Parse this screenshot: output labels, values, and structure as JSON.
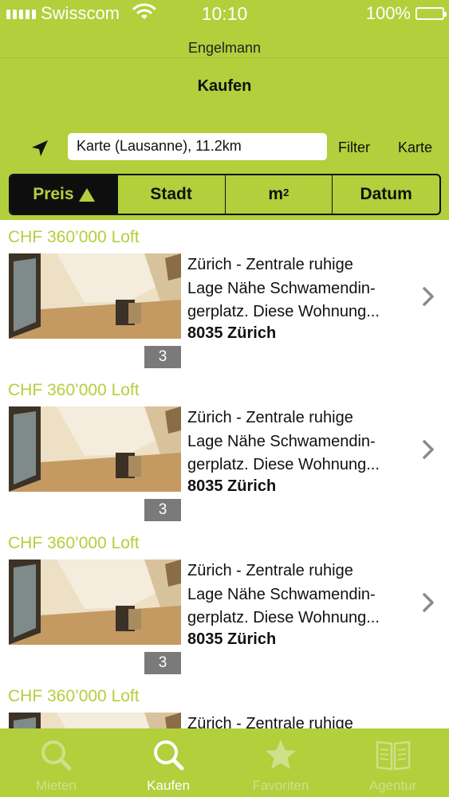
{
  "status_bar": {
    "carrier": "Swisscom",
    "time": "10:10",
    "battery": "100%"
  },
  "header": {
    "brand": "Engelmann",
    "title": "Kaufen"
  },
  "search": {
    "value": "Karte (Lausanne), 11.2km",
    "filter_label": "Filter",
    "map_label": "Karte"
  },
  "sort": {
    "options": [
      "Preis",
      "Stadt",
      "m",
      "Datum"
    ],
    "m_superscript": "2",
    "active": "Preis"
  },
  "listings": [
    {
      "title": "CHF 360’000 Loft",
      "desc": [
        "Zürich - Zentrale ruhige",
        "Lage Nähe Schwamendin-",
        "gerplatz. Diese Wohnung..."
      ],
      "city": "8035 Zürich",
      "photo_count": "3"
    },
    {
      "title": "CHF 360’000 Loft",
      "desc": [
        "Zürich - Zentrale ruhige",
        "Lage Nähe Schwamendin-",
        "gerplatz. Diese Wohnung..."
      ],
      "city": "8035 Zürich",
      "photo_count": "3"
    },
    {
      "title": "CHF 360’000 Loft",
      "desc": [
        "Zürich - Zentrale ruhige",
        "Lage Nähe Schwamendin-",
        "gerplatz. Diese Wohnung..."
      ],
      "city": "8035 Zürich",
      "photo_count": "3"
    },
    {
      "title": "CHF 360’000 Loft",
      "desc": [
        "Zürich - Zentrale ruhige",
        "",
        ""
      ],
      "city": "",
      "photo_count": ""
    }
  ],
  "tabs": [
    {
      "label": "Mieten",
      "icon": "search-icon",
      "active": false
    },
    {
      "label": "Kaufen",
      "icon": "search-icon",
      "active": true
    },
    {
      "label": "Favoriten",
      "icon": "star-icon",
      "active": false
    },
    {
      "label": "Agentur",
      "icon": "book-icon",
      "active": false
    }
  ],
  "colors": {
    "accent": "#b3cf3c",
    "dark": "#0e0e0e",
    "badge": "#7a7a7a"
  }
}
